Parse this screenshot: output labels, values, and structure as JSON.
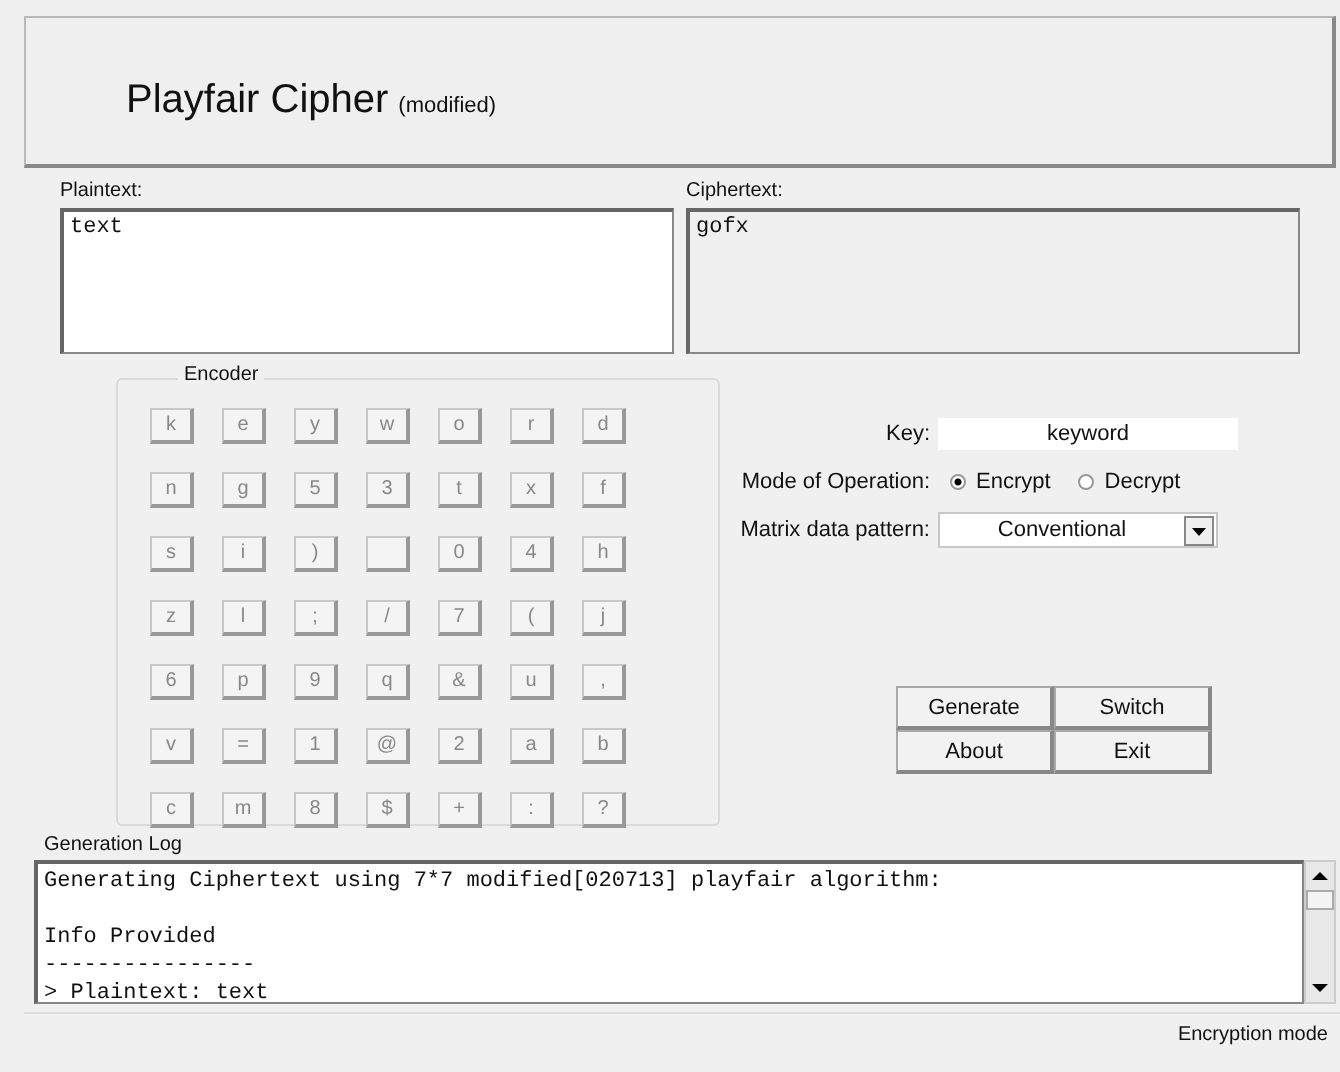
{
  "header": {
    "title": "Playfair Cipher",
    "subtitle": "(modified)"
  },
  "plaintext": {
    "label": "Plaintext:",
    "value": "text"
  },
  "ciphertext": {
    "label": "Ciphertext:",
    "value": "gofx"
  },
  "encoder": {
    "title": "Encoder",
    "rows": [
      [
        {
          "kind": "char",
          "label": "k"
        },
        {
          "kind": "char",
          "label": "e"
        },
        {
          "kind": "char",
          "label": "y"
        },
        {
          "kind": "char",
          "label": "w"
        },
        {
          "kind": "char",
          "label": "o"
        },
        {
          "kind": "char",
          "label": "r"
        },
        {
          "kind": "char",
          "label": "d"
        }
      ],
      [
        {
          "kind": "char",
          "label": "n"
        },
        {
          "kind": "char",
          "label": "g"
        },
        {
          "kind": "char",
          "label": "5"
        },
        {
          "kind": "char",
          "label": "3"
        },
        {
          "kind": "char",
          "label": "t"
        },
        {
          "kind": "char",
          "label": "x"
        },
        {
          "kind": "char",
          "label": "f"
        }
      ],
      [
        {
          "kind": "char",
          "label": "s"
        },
        {
          "kind": "char",
          "label": "i"
        },
        {
          "kind": "char",
          "label": ")"
        },
        {
          "kind": "blank"
        },
        {
          "kind": "char",
          "label": "0"
        },
        {
          "kind": "char",
          "label": "4"
        },
        {
          "kind": "char",
          "label": "h"
        }
      ],
      [
        {
          "kind": "char",
          "label": "z"
        },
        {
          "kind": "char",
          "label": "l"
        },
        {
          "kind": "char",
          "label": ";"
        },
        {
          "kind": "char",
          "label": "/"
        },
        {
          "kind": "char",
          "label": "7"
        },
        {
          "kind": "char",
          "label": "("
        },
        {
          "kind": "char",
          "label": "j"
        }
      ],
      [
        {
          "kind": "char",
          "label": "6"
        },
        {
          "kind": "char",
          "label": "p"
        },
        {
          "kind": "char",
          "label": "9"
        },
        {
          "kind": "char",
          "label": "q"
        },
        {
          "kind": "char",
          "label": "&"
        },
        {
          "kind": "char",
          "label": "u"
        },
        {
          "kind": "char",
          "label": ","
        }
      ],
      [
        {
          "kind": "char",
          "label": "v"
        },
        {
          "kind": "char",
          "label": "="
        },
        {
          "kind": "char",
          "label": "1"
        },
        {
          "kind": "char",
          "label": "@"
        },
        {
          "kind": "char",
          "label": "2"
        },
        {
          "kind": "char",
          "label": "a"
        },
        {
          "kind": "char",
          "label": "b"
        }
      ],
      [
        {
          "kind": "char",
          "label": "c"
        },
        {
          "kind": "char",
          "label": "m"
        },
        {
          "kind": "char",
          "label": "8"
        },
        {
          "kind": "char",
          "label": "$"
        },
        {
          "kind": "char",
          "label": "+"
        },
        {
          "kind": "char",
          "label": ":"
        },
        {
          "kind": "char",
          "label": "?"
        }
      ]
    ]
  },
  "key": {
    "label": "Key:",
    "value": "keyword"
  },
  "mode": {
    "label": "Mode of Operation:",
    "options": [
      {
        "label": "Encrypt",
        "selected": true
      },
      {
        "label": "Decrypt",
        "selected": false
      }
    ]
  },
  "pattern": {
    "label": "Matrix data pattern:",
    "value": "Conventional"
  },
  "buttons": [
    "Generate",
    "Switch",
    "About",
    "Exit"
  ],
  "log": {
    "title": "Generation Log",
    "lines": [
      {
        "kind": "text",
        "text": "Generating Ciphertext using 7*7 modified[020713] playfair algorithm:"
      },
      {
        "kind": "blank"
      },
      {
        "kind": "text",
        "text": "Info Provided"
      },
      {
        "kind": "text",
        "text": "----------------"
      },
      {
        "kind": "text",
        "text": "> Plaintext: text"
      }
    ]
  },
  "status_bar": {
    "text": "Encryption mode"
  }
}
